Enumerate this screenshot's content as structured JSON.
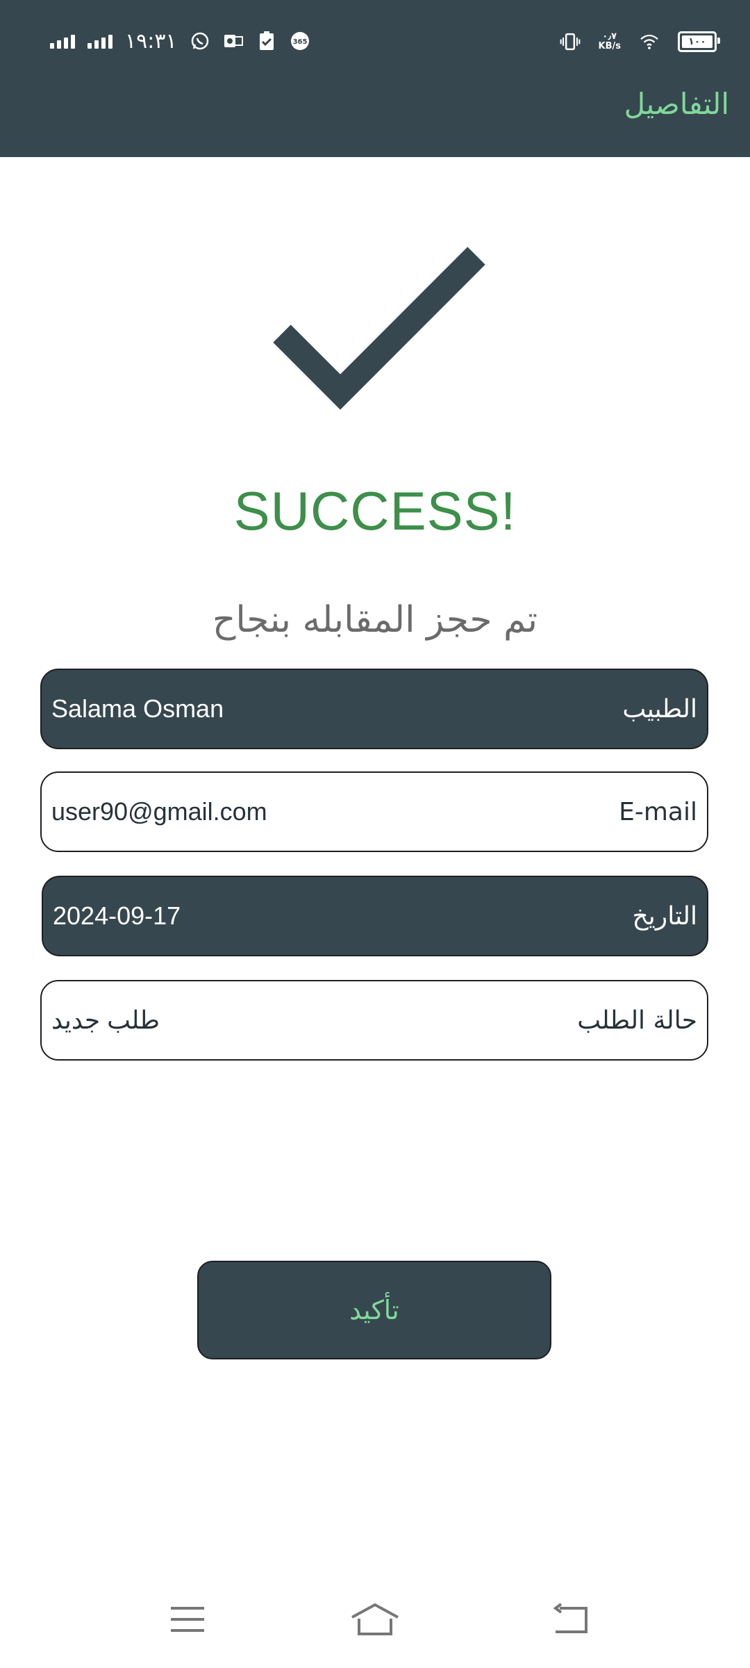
{
  "status_bar": {
    "time": "١٩:٣١",
    "net_speed_value": "٠٫٧",
    "net_speed_unit": "KB/s",
    "battery": "١٠٠",
    "icons": [
      "signal-icon",
      "signal-icon",
      "whatsapp-icon",
      "outlook-icon",
      "clipboard-check-icon",
      "office-365-icon",
      "vibrate-icon",
      "wifi-icon",
      "battery-icon"
    ]
  },
  "header": {
    "title": "التفاصيل"
  },
  "success": {
    "icon": "checkmark-icon",
    "title": "SUCCESS!",
    "subtitle": "تم حجز المقابله بنجاح"
  },
  "details": [
    {
      "label": "الطبيب",
      "value": "Salama Osman",
      "style": "dark"
    },
    {
      "label": "E-mail",
      "value": "user90@gmail.com",
      "style": "light"
    },
    {
      "label": "التاريخ",
      "value": "2024-09-17",
      "style": "dark"
    },
    {
      "label": "حالة الطلب",
      "value": "طلب جديد",
      "style": "light"
    }
  ],
  "confirm_button": {
    "label": "تأكيد"
  },
  "nav": {
    "icons": [
      "menu-icon",
      "home-icon",
      "back-icon"
    ]
  },
  "colors": {
    "primary": "#37474f",
    "accent_green": "#7fd99a",
    "success_green": "#3d8f4a",
    "subtitle_gray": "#6b6b6b"
  }
}
